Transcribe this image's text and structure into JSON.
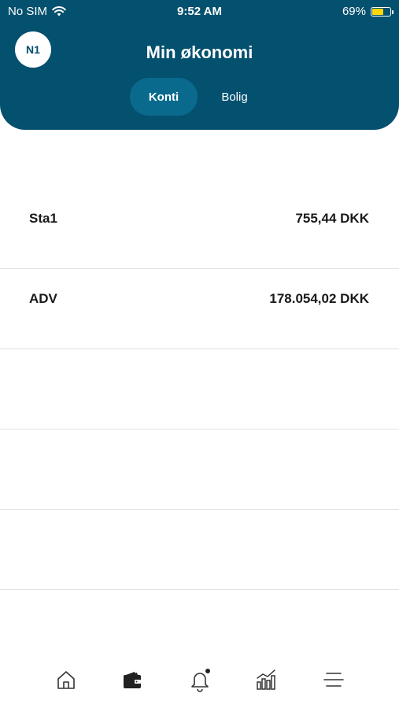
{
  "status": {
    "carrier": "No SIM",
    "time": "9:52 AM",
    "battery": "69%",
    "battery_level": 0.69,
    "battery_color": "#ffd60a"
  },
  "header": {
    "avatar": "N1",
    "title": "Min økonomi",
    "tabs": [
      {
        "label": "Konti",
        "active": true
      },
      {
        "label": "Bolig",
        "active": false
      }
    ],
    "background": "#04506f"
  },
  "accounts": [
    {
      "name": "Sta1",
      "amount": "755,44 DKK"
    },
    {
      "name": "ADV",
      "amount": "178.054,02 DKK"
    }
  ],
  "tabbar": {
    "items": [
      {
        "icon": "home-icon",
        "active": false
      },
      {
        "icon": "wallet-icon",
        "active": true
      },
      {
        "icon": "bell-icon",
        "active": false,
        "has_badge": true
      },
      {
        "icon": "chart-icon",
        "active": false
      },
      {
        "icon": "menu-icon",
        "active": false
      }
    ]
  }
}
